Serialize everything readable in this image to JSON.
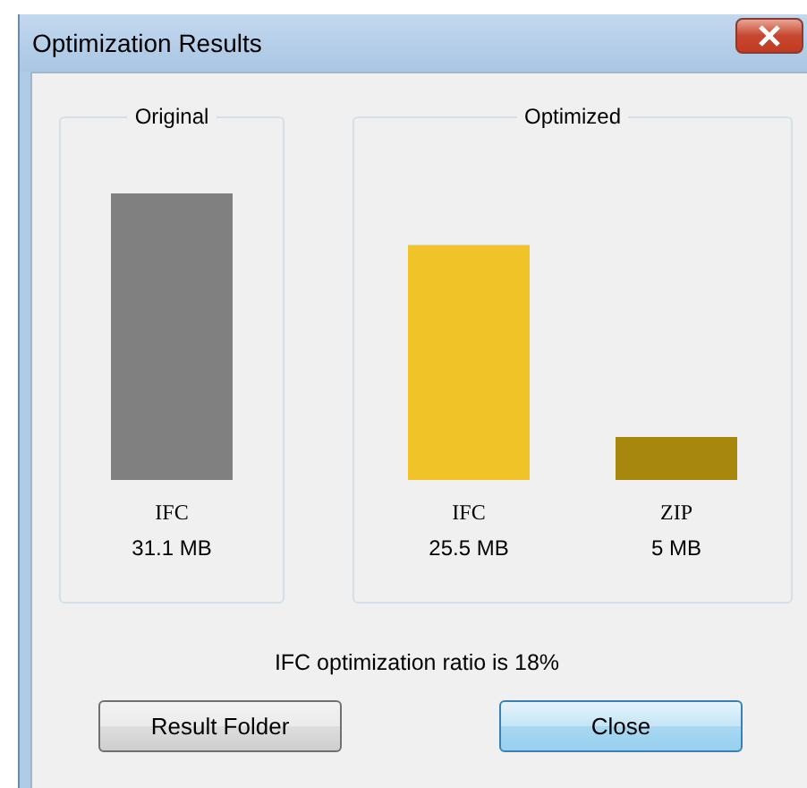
{
  "window": {
    "title": "Optimization Results"
  },
  "groups": [
    {
      "title": "Original",
      "bars": [
        {
          "label": "IFC",
          "size": "31.1 MB",
          "level": 1.0,
          "color": "#808080"
        }
      ]
    },
    {
      "title": "Optimized",
      "bars": [
        {
          "label": "IFC",
          "size": "25.5 MB",
          "level": 0.82,
          "color": "#f0c428"
        },
        {
          "label": "ZIP",
          "size": "5 MB",
          "level": 0.15,
          "color": "#a8870e"
        }
      ]
    }
  ],
  "ratio_text": "IFC optimization ratio is 18%",
  "buttons": [
    {
      "label": "Result Folder",
      "selected": false
    },
    {
      "label": "Close",
      "selected": true
    }
  ]
}
